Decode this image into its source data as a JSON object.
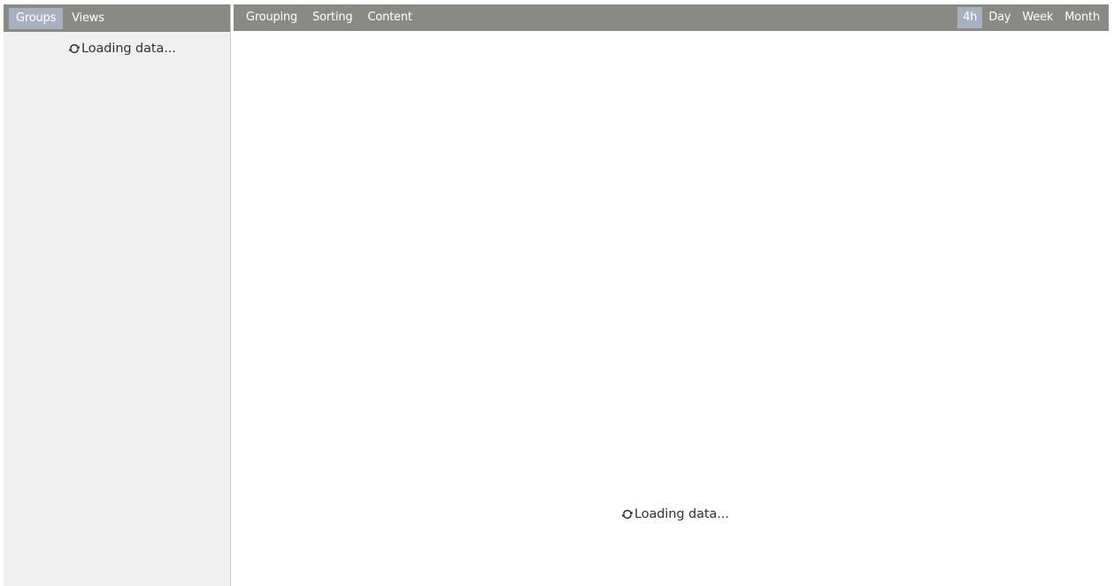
{
  "left_panel": {
    "tabs": [
      {
        "label": "Groups",
        "active": true
      },
      {
        "label": "Views",
        "active": false
      }
    ],
    "loading_text": "Loading data..."
  },
  "main_panel": {
    "toolbar_left": [
      {
        "label": "Grouping"
      },
      {
        "label": "Sorting"
      },
      {
        "label": "Content"
      }
    ],
    "time_scale": [
      {
        "label": "4h",
        "active": true
      },
      {
        "label": "Day",
        "active": false
      },
      {
        "label": "Week",
        "active": false
      },
      {
        "label": "Month",
        "active": false
      }
    ],
    "loading_text": "Loading data..."
  },
  "colors": {
    "toolbar_bg": "#8a8a85",
    "active_tab_bg": "#a7b1bf",
    "left_panel_bg": "#f0f0f0",
    "text": "#333333"
  },
  "icons": {
    "loading": "refresh-icon"
  }
}
